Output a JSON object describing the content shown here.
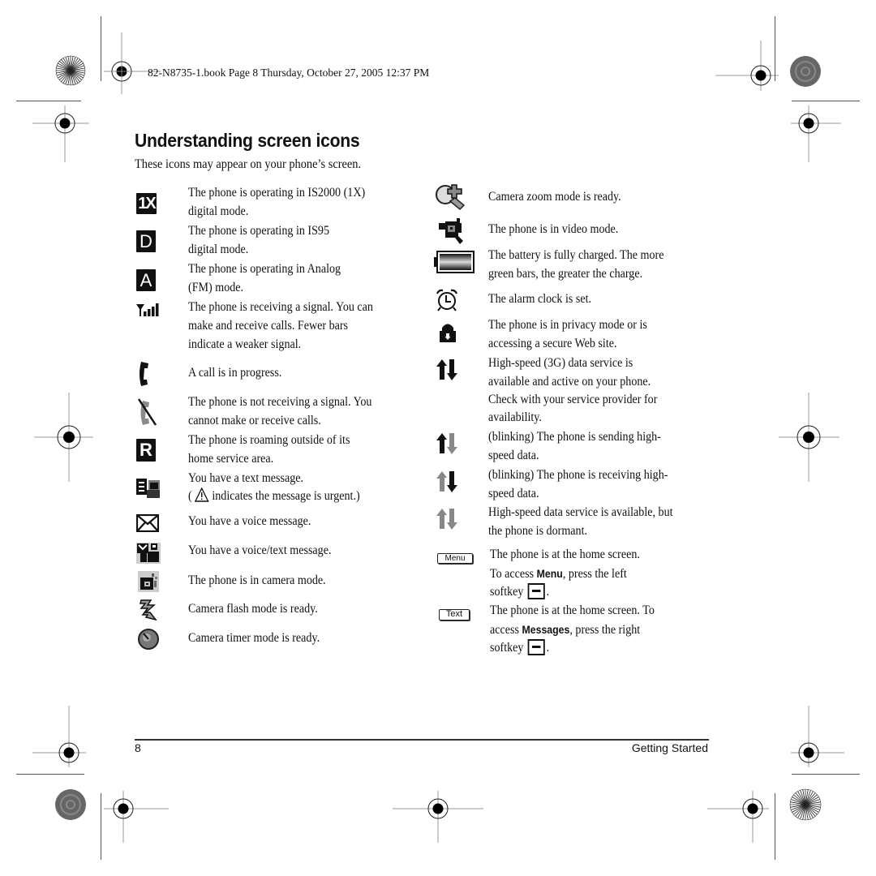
{
  "crop_header": "82-N8735-1.book  Page 8  Thursday, October 27, 2005  12:37 PM",
  "title": "Understanding screen icons",
  "intro": "These icons may appear on your phone’s screen.",
  "left_column": [
    {
      "icon": "1x-digital-icon",
      "glyph": "1X",
      "lines": [
        "The phone is operating in IS2000 (1X)",
        "digital mode."
      ]
    },
    {
      "icon": "d-digital-icon",
      "glyph": "D",
      "lines": [
        "The phone is operating in IS95",
        "digital mode."
      ]
    },
    {
      "icon": "a-analog-icon",
      "glyph": "A",
      "lines": [
        "The phone is operating in Analog",
        "(FM) mode."
      ]
    },
    {
      "icon": "signal-strength-icon",
      "lines": [
        "The phone is receiving a signal. You can",
        "make and receive calls. Fewer bars",
        "indicate a weaker signal."
      ]
    },
    {
      "icon": "call-in-progress-icon",
      "lines": [
        "A call is in progress."
      ]
    },
    {
      "icon": "no-signal-icon",
      "lines": [
        "The phone is not receiving a signal. You",
        "cannot make or receive calls."
      ]
    },
    {
      "icon": "roaming-icon",
      "glyph": "R",
      "lines": [
        "The phone is roaming outside of its",
        "home service area."
      ]
    },
    {
      "icon": "text-message-icon",
      "lines": [
        "You have a text message.",
        "indicates the message is urgent.)"
      ],
      "line2_prefix": "( "
    },
    {
      "icon": "voice-message-icon",
      "lines": [
        "You have a voice message."
      ]
    },
    {
      "icon": "voice-text-message-icon",
      "lines": [
        "You have a voice/text message."
      ]
    },
    {
      "icon": "camera-mode-icon",
      "lines": [
        "The phone is in camera mode."
      ]
    },
    {
      "icon": "camera-flash-icon",
      "lines": [
        "Camera flash mode is ready."
      ]
    },
    {
      "icon": "camera-timer-icon",
      "lines": [
        "Camera timer mode is ready."
      ]
    }
  ],
  "right_column": [
    {
      "icon": "camera-zoom-icon",
      "lines": [
        "Camera zoom mode is ready."
      ]
    },
    {
      "icon": "video-mode-icon",
      "lines": [
        "The phone is in video mode."
      ]
    },
    {
      "icon": "battery-full-icon",
      "lines": [
        "The battery is fully charged. The more",
        "green bars, the greater the charge."
      ]
    },
    {
      "icon": "alarm-clock-icon",
      "lines": [
        "The alarm clock is set."
      ]
    },
    {
      "icon": "privacy-lock-icon",
      "lines": [
        "The phone is in privacy mode or is",
        "accessing a secure Web site."
      ]
    },
    {
      "icon": "data-active-icon",
      "lines": [
        "High-speed (3G) data service is",
        "available and active on your phone.",
        "Check with your service provider for",
        "availability."
      ]
    },
    {
      "icon": "data-sending-icon",
      "lines": [
        "(blinking) The phone is sending high-",
        "speed data."
      ]
    },
    {
      "icon": "data-receiving-icon",
      "lines": [
        "(blinking) The phone is receiving high-",
        "speed data."
      ]
    },
    {
      "icon": "data-dormant-icon",
      "lines": [
        "High-speed data service is available, but",
        "the phone is dormant."
      ]
    },
    {
      "icon": "menu-softkey-label-icon",
      "label": "Menu",
      "line1": "The phone is at the home screen.",
      "line2_pre": "To access ",
      "line2_bold": "Menu",
      "line2_post": ", press the left",
      "line3": "softkey",
      "line3_post": "."
    },
    {
      "icon": "text-softkey-label-icon",
      "label": "Text",
      "line1": "The phone is at the home screen. To",
      "line2_pre": "access ",
      "line2_bold": "Messages",
      "line2_post": ", press the right",
      "line3": "softkey",
      "line3_post": "."
    }
  ],
  "footer": {
    "page_number": "8",
    "section": "Getting Started"
  },
  "colors": {
    "text": "#111111",
    "registration_gray": "#999999",
    "rule": "#333333"
  }
}
